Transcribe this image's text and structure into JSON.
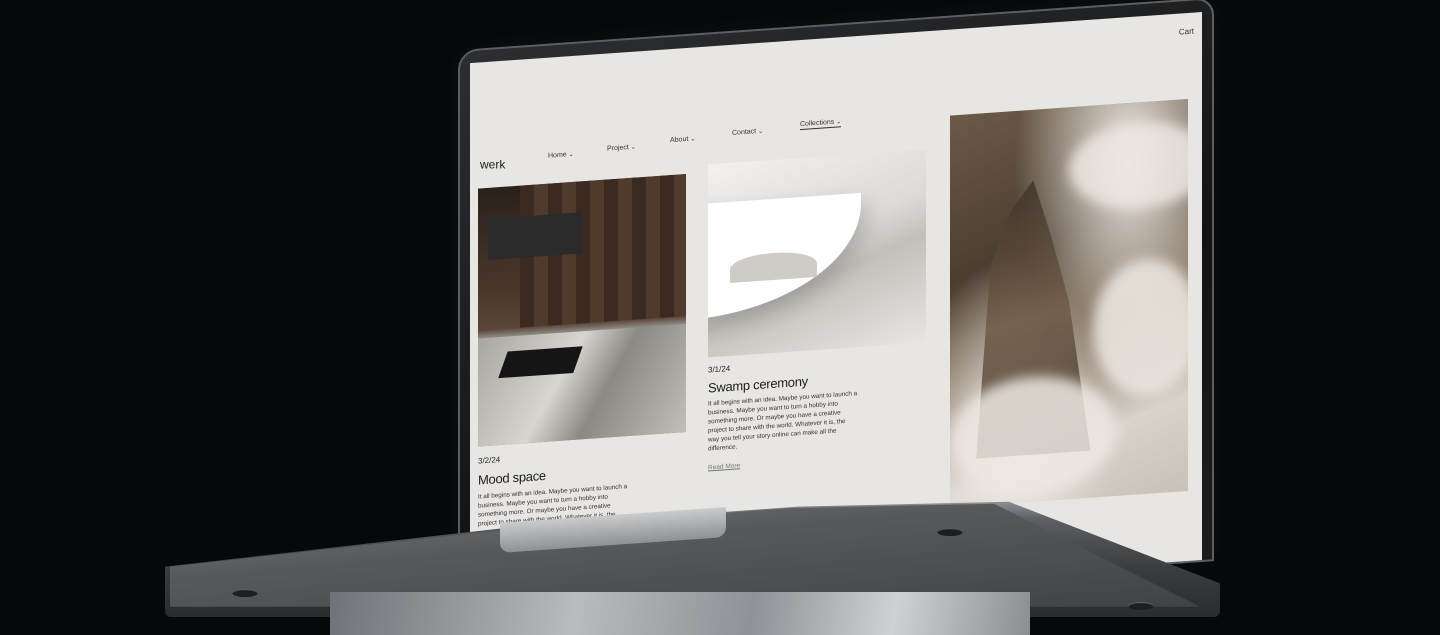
{
  "nav": {
    "logo": "werk",
    "items": [
      {
        "label": "Home",
        "chevron": "⌄"
      },
      {
        "label": "Project",
        "chevron": "⌄"
      },
      {
        "label": "About",
        "chevron": "⌄"
      },
      {
        "label": "Contact",
        "chevron": "⌄"
      },
      {
        "label": "Collections",
        "chevron": "⌄"
      }
    ],
    "cart": "Cart"
  },
  "posts": [
    {
      "date": "3/2/24",
      "title": "Mood space",
      "excerpt": "It all begins with an idea. Maybe you want to launch a business. Maybe you want to turn a hobby into something more. Or maybe you have a creative project to share with the world. Whatever it is, the way you tell your story online can make all the"
    },
    {
      "date": "3/1/24",
      "title": "Swamp ceremony",
      "excerpt": "It all begins with an idea. Maybe you want to launch a business. Maybe you want to turn a hobby into something more. Or maybe you have a creative project to share with the world. Whatever it is, the way you tell your story online can make all the difference.",
      "read_more": "Read More"
    }
  ],
  "colors": {
    "screen_bg": "#e7e6e3",
    "page_bg": "#07080a",
    "text": "#1d1d1d"
  }
}
